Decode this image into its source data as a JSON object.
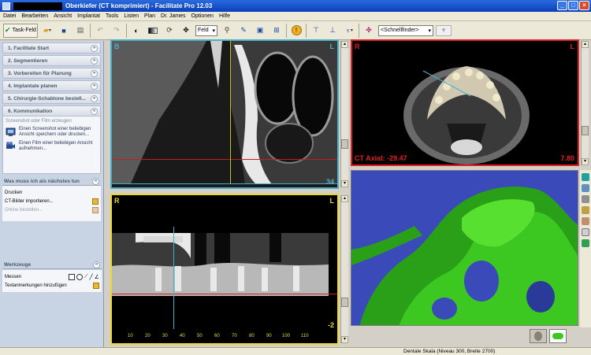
{
  "window": {
    "title": "Oberkiefer (CT komprimiert) - Facilitate Pro  12.03"
  },
  "menu": [
    "Datei",
    "Bearbeiten",
    "Ansicht",
    "Implantat",
    "Tools",
    "Listen",
    "Plan",
    "Dr. James",
    "Optionen",
    "Hilfe"
  ],
  "toolbar": {
    "task_label": "Task-Feld",
    "view_select": "Feld",
    "quick_select": "<Schnellfinder>"
  },
  "steps": [
    {
      "label": "1. Facilitate Start"
    },
    {
      "label": "2. Segmentieren"
    },
    {
      "label": "3. Vorbereiten für Planung"
    },
    {
      "label": "4. Implantate planen"
    },
    {
      "label": "5. Chirurgie-Schablone bestell..."
    },
    {
      "label": "6. Kommunikation"
    }
  ],
  "communication": {
    "subtitle": "Screenshot oder Film erzeugen",
    "actions": [
      {
        "text": "Einen Screenshot einer beliebigen Ansicht speichern oder drucken..."
      },
      {
        "text": "Einen Film einer beliebigen Ansicht aufnehmen..."
      }
    ]
  },
  "next_section": {
    "title": "Was muss ich als nächstes tun",
    "items": [
      {
        "label": "Drucken",
        "enabled": true
      },
      {
        "label": "CT-Bilder importieren...",
        "enabled": true
      },
      {
        "label": "Online bestellen...",
        "enabled": false
      }
    ]
  },
  "tools_section": {
    "title": "Werkzeuge",
    "items": [
      {
        "label": "Messen"
      },
      {
        "label": "Textanmerkungen hinzufügen"
      }
    ]
  },
  "viewports": {
    "sagittal": {
      "left_label": "B",
      "right_label": "L",
      "slice": "34",
      "border": "#4ab0c8"
    },
    "axial": {
      "left_label": "R",
      "right_label": "L",
      "info": "CT Axial: -29.47",
      "value": "7.80",
      "border": "#e02020"
    },
    "panoramic": {
      "left_label": "R",
      "right_label": "L",
      "slice": "-2",
      "ticks": [
        "10",
        "20",
        "30",
        "40",
        "50",
        "60",
        "70",
        "80",
        "90",
        "100",
        "110"
      ],
      "border": "#e8d830"
    },
    "render3d": {
      "background": "#3a4ab8",
      "bone": "#3cc820"
    }
  },
  "status": {
    "text": "Dentale Skala (Niveau 300, Breite 2700)"
  }
}
